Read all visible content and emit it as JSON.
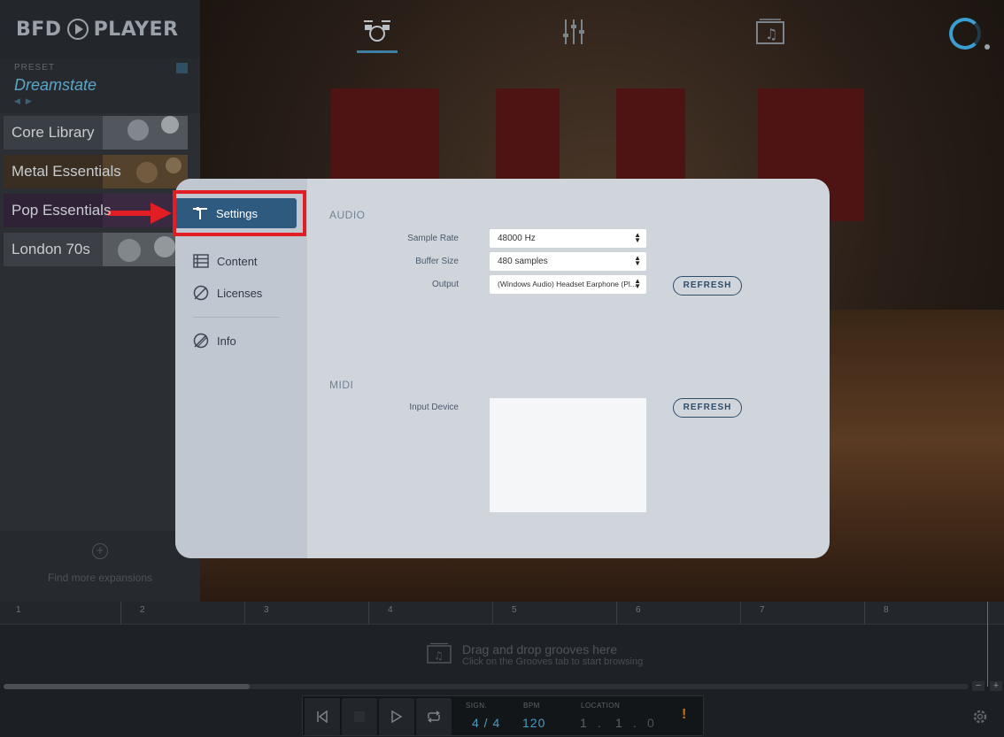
{
  "app": {
    "logo_text": "BFD",
    "logo_text2": "PLAYER"
  },
  "preset": {
    "label": "PRESET",
    "name": "Dreamstate"
  },
  "library": {
    "items": [
      {
        "label": "Core Library"
      },
      {
        "label": "Metal Essentials"
      },
      {
        "label": "Pop Essentials"
      },
      {
        "label": "London 70s"
      }
    ],
    "find_more": "Find more expansions"
  },
  "topnav": {
    "tabs": [
      "drum-kit-icon",
      "mixer-icon",
      "grooves-icon"
    ]
  },
  "settings_modal": {
    "nav": {
      "settings": "Settings",
      "content": "Content",
      "licenses": "Licenses",
      "info": "Info"
    },
    "audio": {
      "title": "AUDIO",
      "sample_rate_label": "Sample Rate",
      "sample_rate_value": "48000 Hz",
      "buffer_size_label": "Buffer Size",
      "buffer_size_value": "480 samples",
      "output_label": "Output",
      "output_value": "(Windows Audio) Headset Earphone (Pl...",
      "refresh_label": "REFRESH"
    },
    "midi": {
      "title": "MIDI",
      "input_device_label": "Input Device",
      "refresh_label": "REFRESH"
    }
  },
  "timeline": {
    "bars": [
      "1",
      "2",
      "3",
      "4",
      "5",
      "6",
      "7",
      "8"
    ]
  },
  "groove_lane": {
    "hint_title": "Drag and drop grooves here",
    "hint_sub": "Click on the Grooves tab to start browsing"
  },
  "zoom": {
    "minus": "−",
    "plus": "+"
  },
  "transport": {
    "sign_label": "SIGN.",
    "sign_value": "4 / 4",
    "bpm_label": "BPM",
    "bpm_value": "120",
    "location_label": "LOCATION",
    "location_bar": "1",
    "location_beat": "1",
    "location_tick": "0",
    "warning": "!"
  },
  "colors": {
    "accent": "#2f5a80",
    "highlight": "#e01e24",
    "preset_name": "#5aa6c8"
  }
}
